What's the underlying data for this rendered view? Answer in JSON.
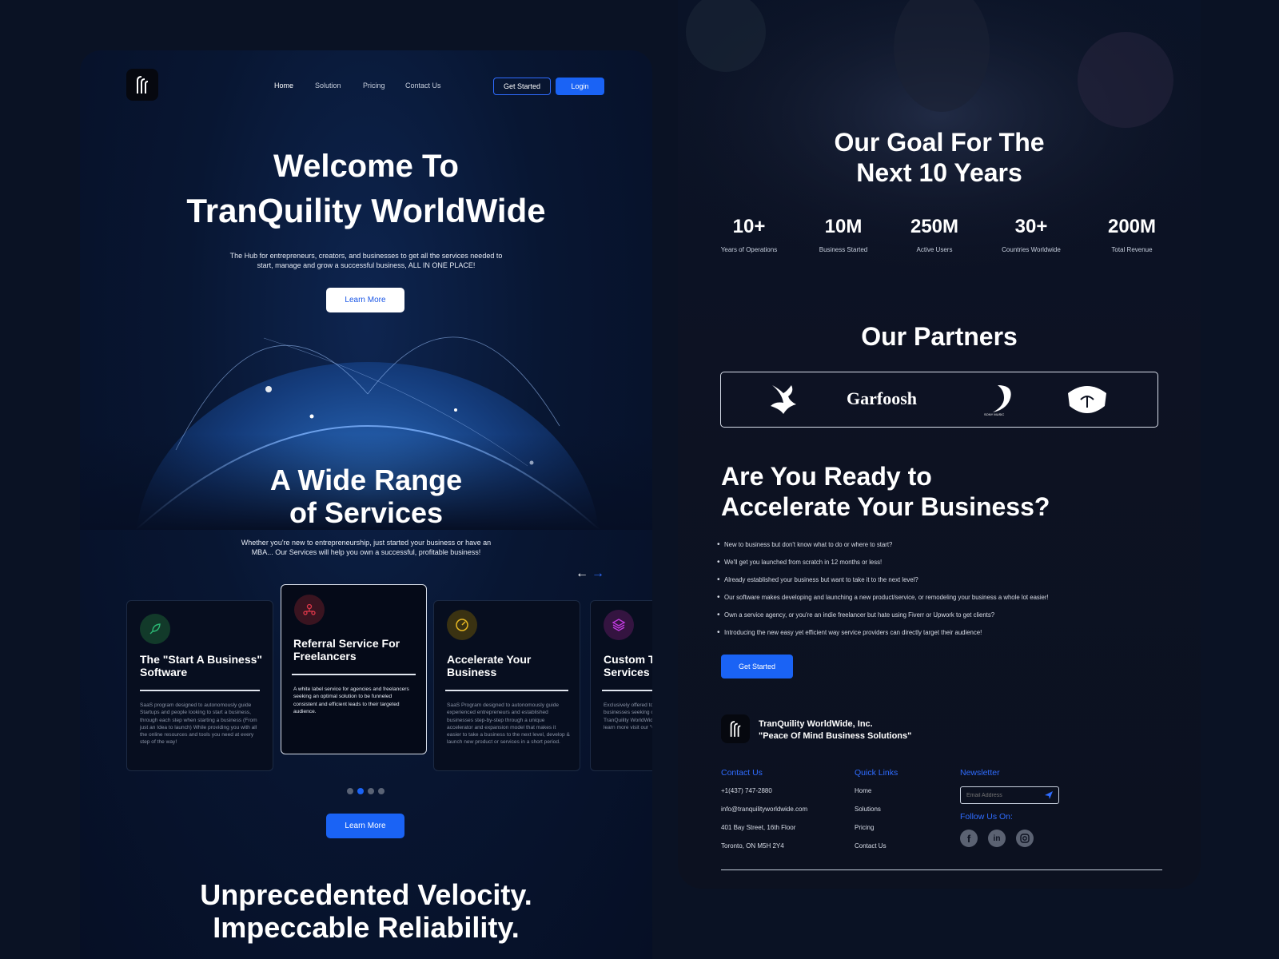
{
  "brand": {
    "name": "TranQuility WorldWide, Inc.",
    "tagline": "\"Peace Of Mind Business Solutions\""
  },
  "nav": {
    "items": [
      "Home",
      "Solution",
      "Pricing",
      "Contact Us"
    ],
    "get_started": "Get Started",
    "login": "Login"
  },
  "hero": {
    "title_line1": "Welcome To",
    "title_line2": "TranQuility WorldWide",
    "subtitle_line1": "The Hub for entrepreneurs, creators, and businesses to get all the services needed to",
    "subtitle_line2": "start, manage and grow a successful business, ALL IN ONE PLACE!",
    "cta": "Learn More"
  },
  "services": {
    "title_line1": "A Wide Range",
    "title_line2": "of Services",
    "subtitle_line1": "Whether you're new to entrepreneurship, just started your business or have an",
    "subtitle_line2": "MBA... Our Services will help you own a successful, profitable business!",
    "cards": [
      {
        "title": "The \"Start A Business\" Software",
        "desc": "SaaS program designed to autonomously guide Startups and people looking to start a business, through each step when starting a business (From just an Idea to launch) While providing you with all the online resources and tools you need at every step of the way!",
        "icon": "rocket-icon",
        "color": "#2bb673"
      },
      {
        "title": "Referral Service For Freelancers",
        "desc": "A white label service for agencies and freelancers seeking an optimal solution to be funneled consistent and efficient leads to their targeted audience.",
        "icon": "people-network-icon",
        "color": "#e0384a"
      },
      {
        "title": "Accelerate Your Business",
        "desc": "SaaS Program designed to autonomously guide experienced entrepreneurs and established businesses step-by-step through a unique accelerator and expansion model that makes it easier to take a business to the next level, develop & launch new product or services in a short period.",
        "icon": "speedometer-icon",
        "color": "#e8b923"
      },
      {
        "title": "Custom Tailored Services",
        "desc": "Exclusively offered to existing clients and businesses seeking custom tailored services with TranQuility WorldWide's team of top advisors.To learn more visit our \"Contact Us\" page.",
        "icon": "layers-icon",
        "color": "#c03be0"
      }
    ],
    "cta": "Learn More"
  },
  "velocity": {
    "line1": "Unprecedented Velocity.",
    "line2": "Impeccable Reliability."
  },
  "goal": {
    "title_line1": "Our Goal For The",
    "title_line2": "Next 10 Years",
    "stats": [
      {
        "value": "10+",
        "label": "Years of Operations"
      },
      {
        "value": "10M",
        "label": "Business Started"
      },
      {
        "value": "250M",
        "label": "Active Users"
      },
      {
        "value": "30+",
        "label": "Countries Worldwide"
      },
      {
        "value": "200M",
        "label": "Total Revenue"
      }
    ]
  },
  "partners": {
    "title": "Our Partners",
    "logos": [
      "bird-logo",
      "Garfoosh",
      "SONY MUSIC",
      "SURF COFFEE"
    ]
  },
  "accelerate": {
    "title_line1": "Are You Ready to",
    "title_line2": "Accelerate Your Business?",
    "bullets": [
      "New to business but don't know what to do or where to start?",
      "We'll get you launched from scratch in 12 months or less!",
      "Already established your business but want to take it to the next level?",
      "Our software makes developing and launching a new product/service, or remodeling your business a whole lot easier!",
      "Own a service agency, or you're an indie freelancer but hate using Fiverr or Upwork to get clients?",
      "Introducing the new easy yet efficient way service providers can directly target their audience!"
    ],
    "cta": "Get Started"
  },
  "footer": {
    "contact_title": "Contact Us",
    "contact": [
      "+1(437) 747-2880",
      "info@tranquilityworldwide.com",
      "401 Bay Street, 16th Floor",
      "Toronto, ON M5H 2Y4"
    ],
    "links_title": "Quick Links",
    "links": [
      "Home",
      "Solutions",
      "Pricing",
      "Contact Us"
    ],
    "newsletter_title": "Newsletter",
    "email_placeholder": "Email Address",
    "follow_title": "Follow Us On:"
  }
}
